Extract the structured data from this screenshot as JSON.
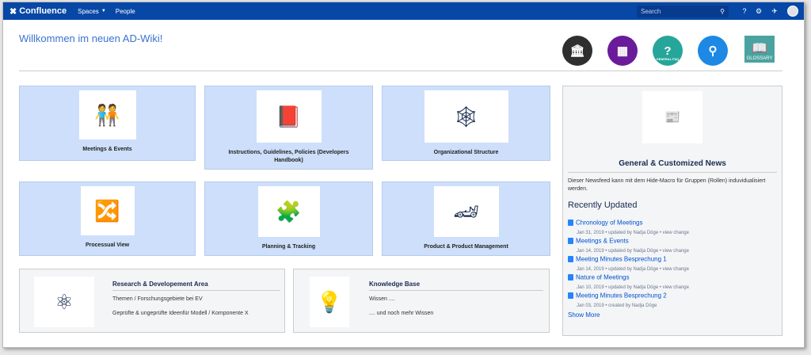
{
  "topbar": {
    "app_name": "Confluence",
    "nav": [
      {
        "label": "Spaces"
      },
      {
        "label": "People"
      }
    ],
    "search_placeholder": "Search"
  },
  "welcome": "Willkommen im neuen AD-Wiki!",
  "quick_links": [
    {
      "icon": "bank-icon",
      "color": "#2f2f2f"
    },
    {
      "icon": "presentation-icon",
      "color": "#6a1b9a"
    },
    {
      "icon": "question-icon",
      "color": "#26a69a",
      "caption": "GENERAL FAQ"
    },
    {
      "icon": "person-search-icon",
      "color": "#1e88e5"
    },
    {
      "icon": "book-icon",
      "caption": "GLOSSARY"
    }
  ],
  "tiles": [
    {
      "label": "Meetings & Events"
    },
    {
      "label": "Instructions, Guidelines, Policies (Developers Handbook)"
    },
    {
      "label": "Organizational Structure"
    },
    {
      "label": "Processual View"
    },
    {
      "label": "Planning & Tracking"
    },
    {
      "label": "Product & Product Management"
    }
  ],
  "wide_tiles": [
    {
      "title": "Research & Developement Area",
      "lines": [
        "Themen / Forschungsgebiete bei EV",
        "Geprüfte & ungeprüfte Ideenfür Modell / Komponente X"
      ]
    },
    {
      "title": "Knowledge Base",
      "lines": [
        "Wissen ....",
        ".... und noch mehr Wissen"
      ]
    }
  ],
  "news": {
    "title": "General & Customized News",
    "description": "Dieser Newsfeed kann mit dem Hide-Macro für Gruppen (Rollen) induvidualisiert werden.",
    "recent_heading": "Recently Updated",
    "items": [
      {
        "title": "Chronology of Meetings",
        "meta": "Jan 31, 2019 • updated by Nadja Döge • view change"
      },
      {
        "title": "Meetings & Events",
        "meta": "Jan 14, 2019 • updated by Nadja Döge • view change"
      },
      {
        "title": "Meeting Minutes Besprechung 1",
        "meta": "Jan 14, 2019 • updated by Nadja Döge • view change"
      },
      {
        "title": "Nature of Meetings",
        "meta": "Jan 10, 2019 • updated by Nadja Döge • view change"
      },
      {
        "title": "Meeting Minutes Besprechung 2",
        "meta": "Jan 03, 2019 • created by Nadja Döge"
      }
    ],
    "show_more": "Show More"
  }
}
